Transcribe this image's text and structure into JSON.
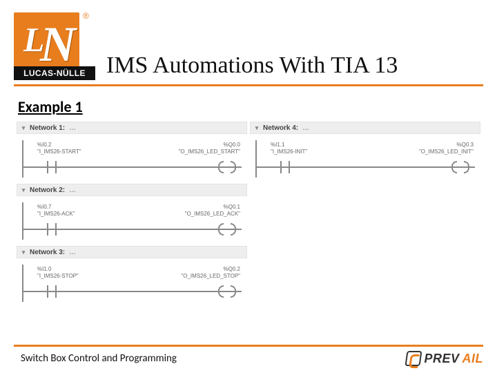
{
  "header": {
    "title": "IMS Automations With TIA 13",
    "logo": {
      "brand": "LUCAS-NÜLLE",
      "reg": "®",
      "L": "L",
      "N": "N"
    }
  },
  "section_title": "Example 1",
  "networks_left": [
    {
      "title": "Network 1:",
      "dots": "…",
      "in_addr": "%I0.2",
      "in_name": "\"I_IMS26-START\"",
      "out_addr": "%Q0.0",
      "out_name": "\"O_IMS26_LED_START\""
    },
    {
      "title": "Network 2:",
      "dots": "…",
      "in_addr": "%I0.7",
      "in_name": "\"I_IMS26-ACK\"",
      "out_addr": "%Q0.1",
      "out_name": "\"O_IMS26_LED_ACK\""
    },
    {
      "title": "Network 3:",
      "dots": "…",
      "in_addr": "%I1.0",
      "in_name": "\"I_IMS26-STOP\"",
      "out_addr": "%Q0.2",
      "out_name": "\"O_IMS26_LED_STOP\""
    }
  ],
  "networks_right": [
    {
      "title": "Network 4:",
      "dots": "…",
      "in_addr": "%I1.1",
      "in_name": "\"I_IMS26-INIT\"",
      "out_addr": "%Q0.3",
      "out_name": "\"O_IMS26_LED_INIT\""
    }
  ],
  "footer": {
    "text": "Switch Box Control and Programming",
    "prevail": {
      "part1": "PREV",
      "part2": "AIL"
    }
  },
  "icons": {
    "chevron": "▾"
  }
}
